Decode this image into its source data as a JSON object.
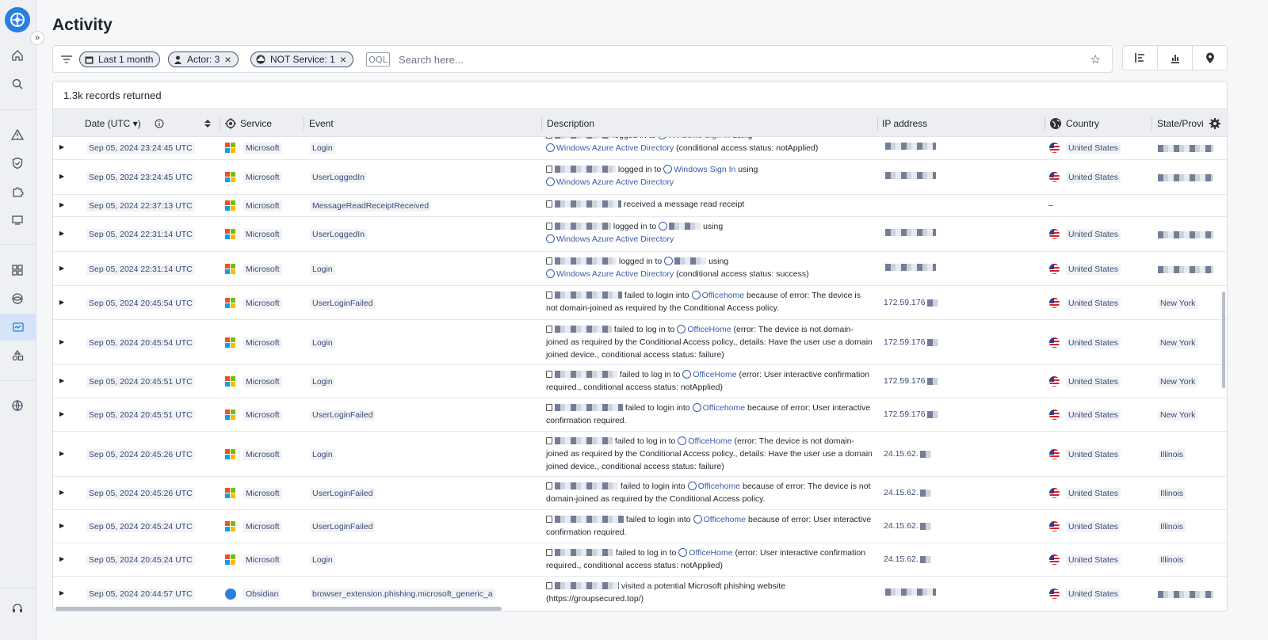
{
  "page": {
    "title": "Activity"
  },
  "sidebar": {
    "expand_label": "»",
    "items": [
      {
        "icon": "home-icon"
      },
      {
        "icon": "search-icon"
      },
      {
        "icon": "alert-icon"
      },
      {
        "icon": "shield-check-icon"
      },
      {
        "icon": "puzzle-icon"
      },
      {
        "icon": "device-icon"
      },
      {
        "icon": "dashboard-icon"
      },
      {
        "icon": "eye-icon"
      },
      {
        "icon": "activity-icon"
      },
      {
        "icon": "shapes-icon"
      },
      {
        "icon": "globe-icon"
      },
      {
        "icon": "support-icon"
      }
    ]
  },
  "filters": {
    "chips": [
      {
        "label": "Last 1 month",
        "icon": "calendar-icon",
        "removable": false
      },
      {
        "label": "Actor: 3",
        "icon": "person-icon",
        "removable": true
      },
      {
        "label": "NOT Service: 1",
        "icon": "cloud-icon",
        "removable": true
      }
    ],
    "oql_label": "OQL",
    "search_placeholder": "Search here..."
  },
  "table": {
    "records_text": "1.3k records returned",
    "headers": {
      "date": "Date (UTC ▾)",
      "service": "Service",
      "event": "Event",
      "description": "Description",
      "ip": "IP address",
      "country": "Country",
      "state": "State/Provi"
    },
    "rows": [
      {
        "date": "Sep 05, 2024 23:24:45 UTC",
        "service": "Microsoft",
        "event": "Login",
        "desc_a": "logged in to",
        "desc_link": "Windows Sign In",
        "desc_b": "using",
        "desc_link2": "Windows Azure Active Directory",
        "desc_c": "(conditional access status: notApplied)",
        "ip": "",
        "country": "United States",
        "state": ""
      },
      {
        "date": "Sep 05, 2024 23:24:45 UTC",
        "service": "Microsoft",
        "event": "UserLoggedIn",
        "desc_a": "logged in to",
        "desc_link": "Windows Sign In",
        "desc_b": "using",
        "desc_link2": "Windows Azure Active Directory",
        "desc_c": "",
        "ip": "",
        "country": "United States",
        "state": ""
      },
      {
        "date": "Sep 05, 2024 22:37:13 UTC",
        "service": "Microsoft",
        "event": "MessageReadReceiptReceived",
        "desc_a": "received a message read receipt",
        "desc_link": "",
        "desc_b": "",
        "desc_link2": "",
        "desc_c": "",
        "ip": "",
        "country": "–",
        "state": ""
      },
      {
        "date": "Sep 05, 2024 22:31:14 UTC",
        "service": "Microsoft",
        "event": "UserLoggedIn",
        "desc_a": "logged in to",
        "desc_link": "",
        "desc_b": "using",
        "desc_link2": "Windows Azure Active Directory",
        "desc_c": "",
        "ip": "",
        "country": "United States",
        "state": ""
      },
      {
        "date": "Sep 05, 2024 22:31:14 UTC",
        "service": "Microsoft",
        "event": "Login",
        "desc_a": "logged in to",
        "desc_link": "",
        "desc_b": "using",
        "desc_link2": "Windows Azure Active Directory",
        "desc_c": "(conditional access status: success)",
        "ip": "",
        "country": "United States",
        "state": ""
      },
      {
        "date": "Sep 05, 2024 20:45:54 UTC",
        "service": "Microsoft",
        "event": "UserLoginFailed",
        "desc_a": "failed to login into",
        "desc_link": "Officehome",
        "desc_b": "because of error: The device is not domain-joined as required by the Conditional Access policy.",
        "desc_link2": "",
        "desc_c": "",
        "ip": "172.59.176",
        "country": "United States",
        "state": "New York"
      },
      {
        "date": "Sep 05, 2024 20:45:54 UTC",
        "service": "Microsoft",
        "event": "Login",
        "desc_a": "failed to log in to",
        "desc_link": "OfficeHome",
        "desc_b": "(error: The device is not domain-joined as required by the Conditional Access policy., details: Have the user use a domain joined device., conditional access status: failure)",
        "desc_link2": "",
        "desc_c": "",
        "ip": "172.59.176",
        "country": "United States",
        "state": "New York"
      },
      {
        "date": "Sep 05, 2024 20:45:51 UTC",
        "service": "Microsoft",
        "event": "Login",
        "desc_a": "failed to log in to",
        "desc_link": "OfficeHome",
        "desc_b": "(error: User interactive confirmation required., conditional access status: notApplied)",
        "desc_link2": "",
        "desc_c": "",
        "ip": "172.59.176",
        "country": "United States",
        "state": "New York"
      },
      {
        "date": "Sep 05, 2024 20:45:51 UTC",
        "service": "Microsoft",
        "event": "UserLoginFailed",
        "desc_a": "failed to login into",
        "desc_link": "Officehome",
        "desc_b": "because of error: User interactive confirmation required.",
        "desc_link2": "",
        "desc_c": "",
        "ip": "172.59.176",
        "country": "United States",
        "state": "New York"
      },
      {
        "date": "Sep 05, 2024 20:45:26 UTC",
        "service": "Microsoft",
        "event": "Login",
        "desc_a": "failed to log in to",
        "desc_link": "OfficeHome",
        "desc_b": "(error: The device is not domain-joined as required by the Conditional Access policy., details: Have the user use a domain joined device., conditional access status: failure)",
        "desc_link2": "",
        "desc_c": "",
        "ip": "24.15.62.",
        "country": "United States",
        "state": "Illinois"
      },
      {
        "date": "Sep 05, 2024 20:45:26 UTC",
        "service": "Microsoft",
        "event": "UserLoginFailed",
        "desc_a": "failed to login into",
        "desc_link": "Officehome",
        "desc_b": "because of error: The device is not domain-joined as required by the Conditional Access policy.",
        "desc_link2": "",
        "desc_c": "",
        "ip": "24.15.62.",
        "country": "United States",
        "state": "Illinois"
      },
      {
        "date": "Sep 05, 2024 20:45:24 UTC",
        "service": "Microsoft",
        "event": "UserLoginFailed",
        "desc_a": "failed to login into",
        "desc_link": "Officehome",
        "desc_b": "because of error: User interactive confirmation required.",
        "desc_link2": "",
        "desc_c": "",
        "ip": "24.15.62.",
        "country": "United States",
        "state": "Illinois"
      },
      {
        "date": "Sep 05, 2024 20:45:24 UTC",
        "service": "Microsoft",
        "event": "Login",
        "desc_a": "failed to log in to",
        "desc_link": "OfficeHome",
        "desc_b": "(error: User interactive confirmation required., conditional access status: notApplied)",
        "desc_link2": "",
        "desc_c": "",
        "ip": "24.15.62.",
        "country": "United States",
        "state": "Illinois"
      },
      {
        "date": "Sep 05, 2024 20:44:57 UTC",
        "service": "Obsidian",
        "event": "browser_extension.phishing.microsoft_generic_a",
        "desc_a": "visited a potential Microsoft phishing website (https://groupsecured.top/)",
        "desc_link": "",
        "desc_b": "",
        "desc_link2": "",
        "desc_c": "",
        "ip": "",
        "country": "United States",
        "state": ""
      }
    ]
  },
  "colors": {
    "accent": "#2a7de1",
    "link": "#3a5aa8",
    "header_bg": "#eceef1"
  }
}
